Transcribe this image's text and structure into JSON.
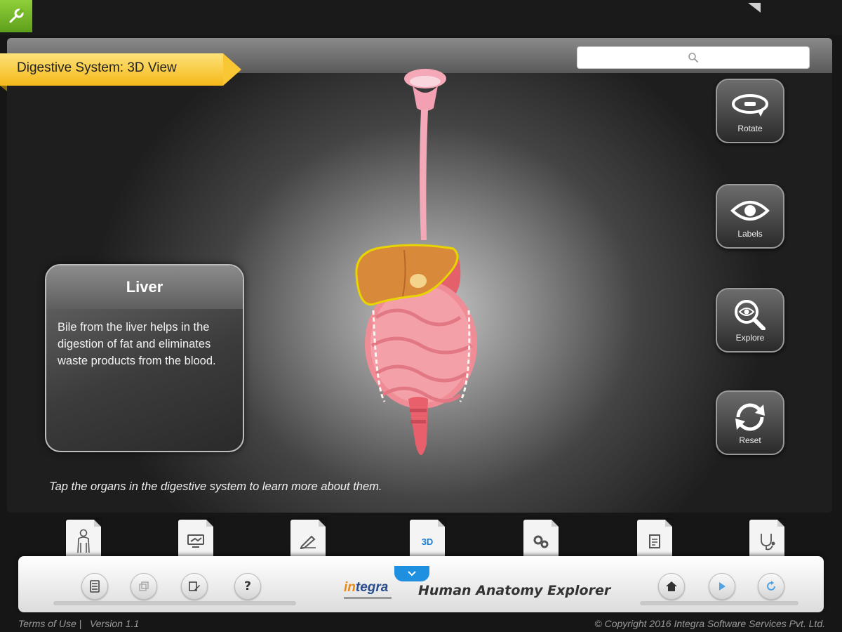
{
  "header": {
    "view_title": "Digestive System: 3D View",
    "search_icon": "search-icon"
  },
  "info_card": {
    "title": "Liver",
    "description": "Bile from the liver helps in the digestion of fat and eliminates waste products from the blood."
  },
  "hint": "Tap the organs in the digestive system to learn more about them.",
  "side_tools": [
    {
      "label": "Rotate",
      "icon": "rotate-icon"
    },
    {
      "label": "Labels",
      "icon": "eye-icon"
    },
    {
      "label": "Explore",
      "icon": "magnifier-eye-icon"
    },
    {
      "label": "Reset",
      "icon": "reset-icon"
    }
  ],
  "tabs": [
    {
      "icon": "body-outline-icon"
    },
    {
      "icon": "monitor-icon"
    },
    {
      "icon": "pencil-icon"
    },
    {
      "label": "3D",
      "icon": "3d-icon",
      "active": true
    },
    {
      "icon": "gears-icon"
    },
    {
      "icon": "document-icon"
    },
    {
      "icon": "stethoscope-icon"
    }
  ],
  "dock": {
    "brand": "integra",
    "app_name": "Human Anatomy Explorer",
    "help_label": "?"
  },
  "footer": {
    "terms": "Terms of Use",
    "separator": "|",
    "version": "Version 1.1",
    "copyright": "© Copyright 2016 Integra Software Services Pvt. Ltd."
  },
  "colors": {
    "accent_yellow": "#f5b818",
    "tool_green": "#6fb526",
    "active_blue": "#1a7fd6",
    "liver_outline": "#e8d400"
  }
}
